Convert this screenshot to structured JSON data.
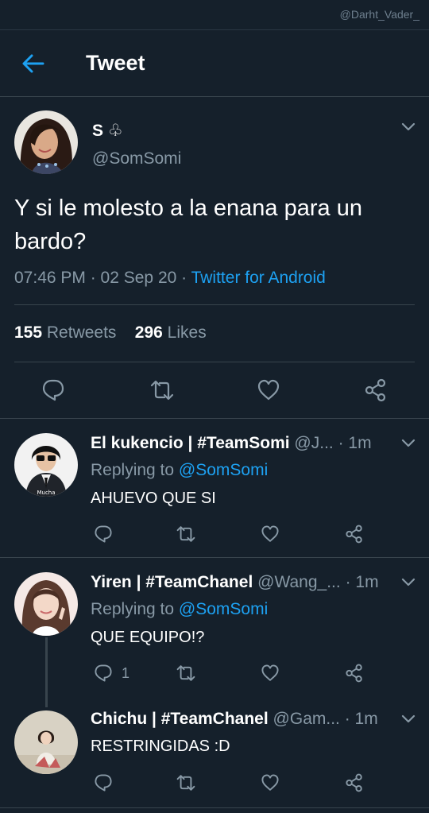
{
  "watermark": "@Darht_Vader_",
  "header": {
    "title": "Tweet"
  },
  "main_tweet": {
    "name": "S ♧",
    "handle": "@SomSomi",
    "text": "Y si le molesto a la enana para un bardo?",
    "time": "07:46 PM · 02 Sep 20 · ",
    "source": "Twitter for Android",
    "retweets_count": "155",
    "retweets_label": "Retweets",
    "likes_count": "296",
    "likes_label": "Likes"
  },
  "replies": [
    {
      "name": "El kukencio | #TeamSomi",
      "handle": "@J...",
      "time": "· 1m",
      "replying_label": "Replying to ",
      "replying_to": "@SomSomi",
      "text": "AHUEVO QUE SI",
      "avatar_caption": "Mucha",
      "reply_count": ""
    },
    {
      "name": "Yiren | #TeamChanel",
      "handle": "@Wang_...",
      "time": "· 1m",
      "replying_label": "Replying to ",
      "replying_to": "@SomSomi",
      "text": "QUE EQUIPO!?",
      "reply_count": "1"
    },
    {
      "name": "Chichu | #TeamChanel",
      "handle": "@Gam...",
      "time": "· 1m",
      "text": "RESTRINGIDAS :D",
      "reply_count": ""
    }
  ],
  "icons": {
    "back": "arrow-left-icon",
    "reply": "reply-icon",
    "retweet": "retweet-icon",
    "like": "heart-icon",
    "share": "share-icon",
    "more": "chevron-down-icon"
  },
  "colors": {
    "background": "#15202b",
    "accent": "#1da1f2",
    "muted": "#8899a6",
    "divider": "#38444d"
  }
}
